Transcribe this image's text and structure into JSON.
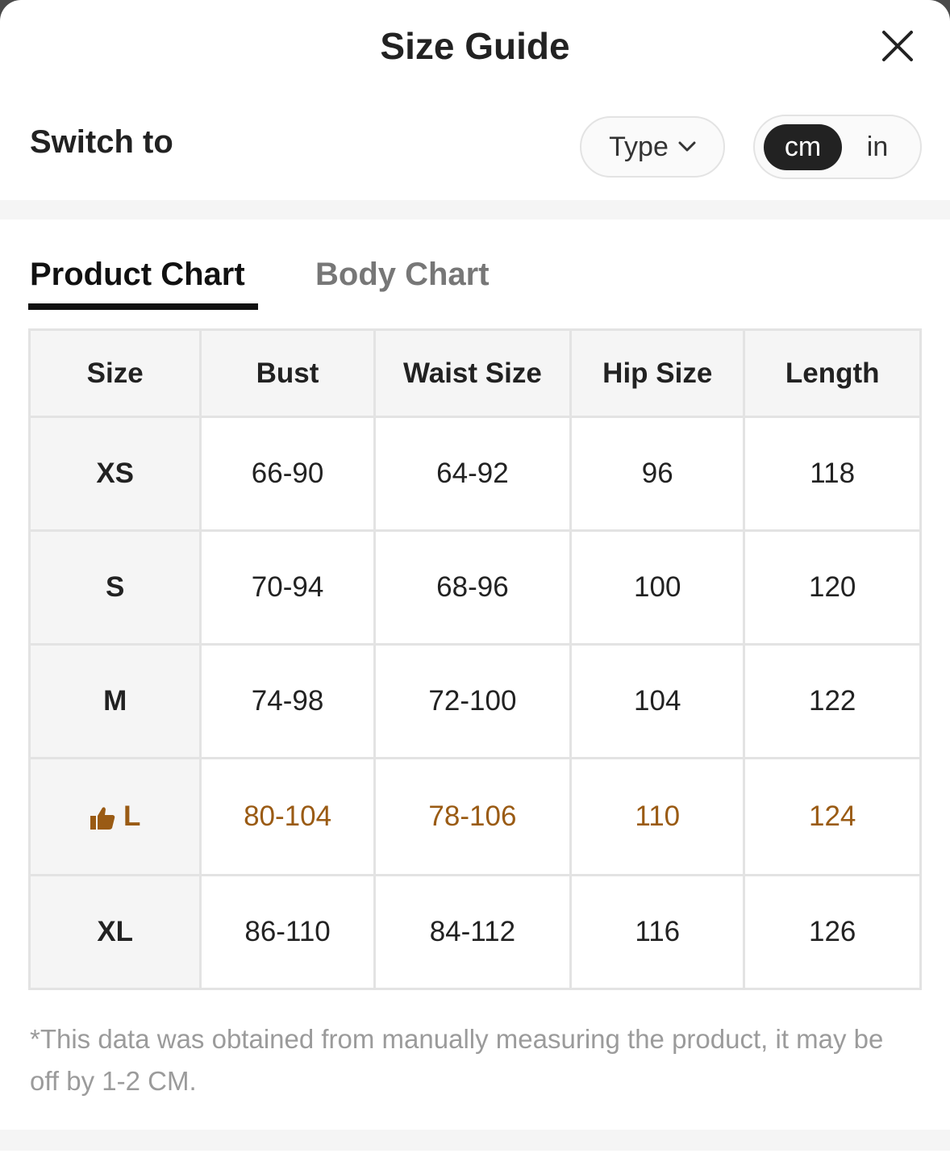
{
  "header": {
    "title": "Size Guide"
  },
  "switch": {
    "label": "Switch to",
    "type_label": "Type",
    "units": [
      "cm",
      "in"
    ],
    "selected_unit": "cm"
  },
  "tabs": [
    {
      "label": "Product Chart",
      "active": true
    },
    {
      "label": "Body Chart",
      "active": false
    }
  ],
  "table": {
    "headers": [
      "Size",
      "Bust",
      "Waist Size",
      "Hip Size",
      "Length"
    ],
    "rows": [
      {
        "size": "XS",
        "bust": "66-90",
        "waist": "64-92",
        "hip": "96",
        "length": "118",
        "recommended": false
      },
      {
        "size": "S",
        "bust": "70-94",
        "waist": "68-96",
        "hip": "100",
        "length": "120",
        "recommended": false
      },
      {
        "size": "M",
        "bust": "74-98",
        "waist": "72-100",
        "hip": "104",
        "length": "122",
        "recommended": false
      },
      {
        "size": "L",
        "bust": "80-104",
        "waist": "78-106",
        "hip": "110",
        "length": "124",
        "recommended": true
      },
      {
        "size": "XL",
        "bust": "86-110",
        "waist": "84-112",
        "hip": "116",
        "length": "126",
        "recommended": false
      }
    ]
  },
  "note": "*This data was obtained from manually measuring the product, it may be off by 1-2 CM.",
  "icons": {
    "close": "close-icon",
    "chevron": "chevron-down-icon",
    "recommend": "thumbs-up-icon"
  },
  "colors": {
    "highlight": "#9a5b14",
    "active_toggle": "#222222"
  }
}
